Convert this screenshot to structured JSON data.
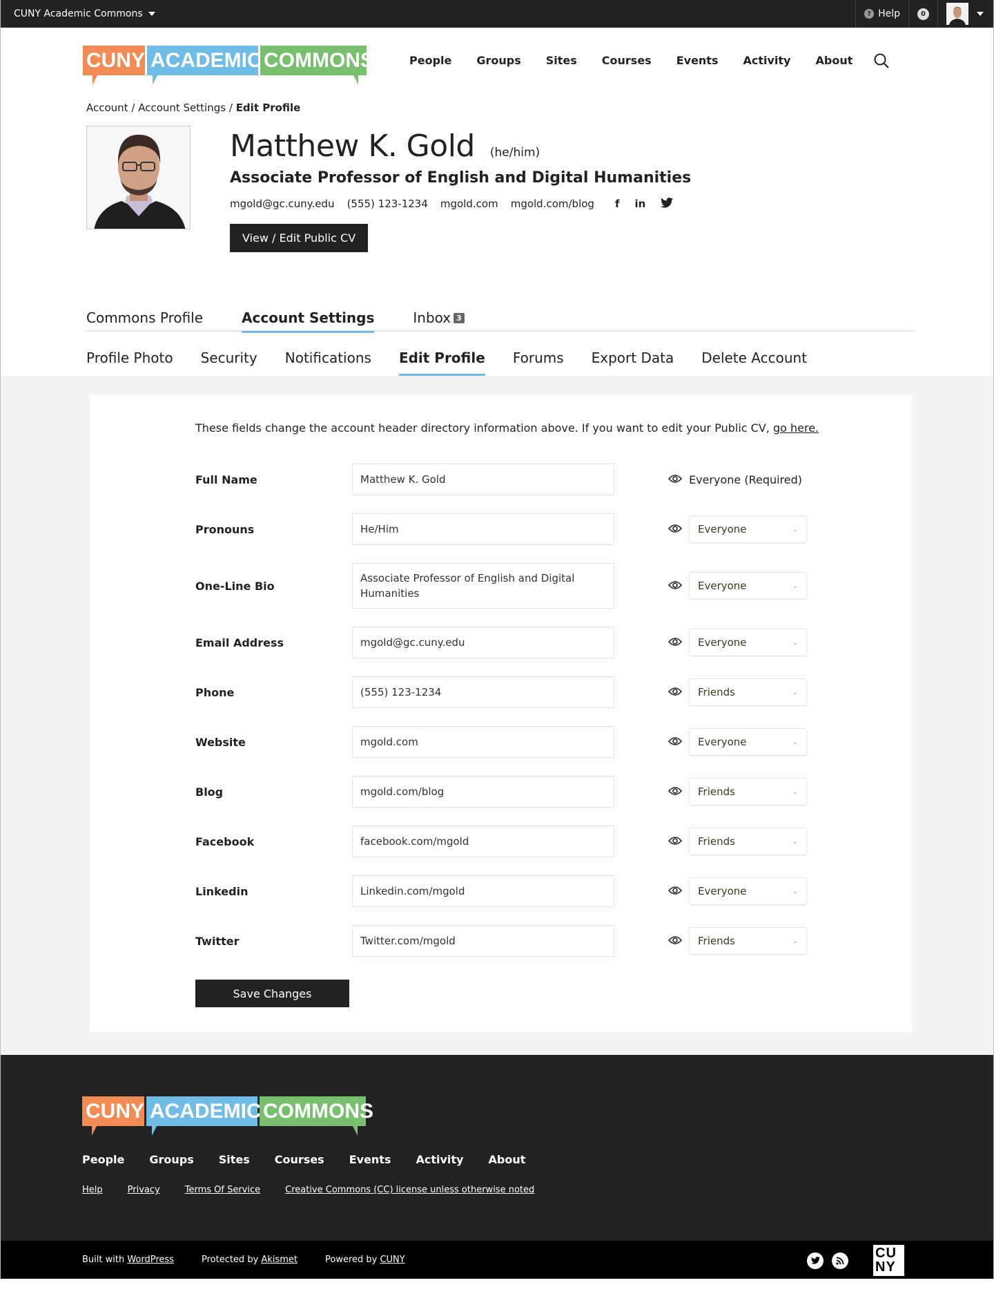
{
  "adminbar": {
    "site_name": "CUNY Academic Commons",
    "help_label": "Help",
    "notification_count": "0"
  },
  "logo": {
    "part1": "CUNY",
    "part2": "ACADEMIC",
    "part3": "COMMONS"
  },
  "nav": [
    "People",
    "Groups",
    "Sites",
    "Courses",
    "Events",
    "Activity",
    "About"
  ],
  "breadcrumb": {
    "item1": "Account",
    "item2": "Account Settings",
    "current": "Edit Profile",
    "separator": "/"
  },
  "profile": {
    "name": "Matthew K. Gold",
    "pronouns": "(he/him)",
    "title": "Associate Professor of English and Digital Humanities",
    "email": "mgold@gc.cuny.edu",
    "phone": "(555) 123-1234",
    "website": "mgold.com",
    "blog": "mgold.com/blog",
    "social": {
      "facebook": "f",
      "linkedin": "in"
    },
    "cv_button": "View / Edit Public CV"
  },
  "tabs": [
    {
      "label": "Commons Profile"
    },
    {
      "label": "Account Settings"
    },
    {
      "label": "Inbox",
      "count": "3"
    }
  ],
  "subtabs": [
    "Profile Photo",
    "Security",
    "Notifications",
    "Edit Profile",
    "Forums",
    "Export Data",
    "Delete Account"
  ],
  "form": {
    "intro": "These fields change the account header directory information above. If you want to edit your Public CV, ",
    "intro_link": "go here.",
    "fields": [
      {
        "label": "Full Name",
        "value": "Matthew K. Gold",
        "visibility": "Everyone (Required)"
      },
      {
        "label": "Pronouns",
        "value": "He/Him",
        "visibility": "Everyone"
      },
      {
        "label": "One-Line Bio",
        "value": "Associate Professor of English and Digital Humanities",
        "visibility": "Everyone"
      },
      {
        "label": "Email Address",
        "value": "mgold@gc.cuny.edu",
        "visibility": "Everyone"
      },
      {
        "label": "Phone",
        "value": "(555) 123-1234",
        "visibility": "Friends"
      },
      {
        "label": "Website",
        "value": "mgold.com",
        "visibility": "Everyone"
      },
      {
        "label": "Blog",
        "value": "mgold.com/blog",
        "visibility": "Friends"
      },
      {
        "label": "Facebook",
        "value": "facebook.com/mgold",
        "visibility": "Friends"
      },
      {
        "label": "Linkedin",
        "value": "Linkedin.com/mgold",
        "visibility": "Everyone"
      },
      {
        "label": "Twitter",
        "value": "Twitter.com/mgold",
        "visibility": "Friends"
      }
    ],
    "save_label": "Save Changes"
  },
  "footer": {
    "nav": [
      "People",
      "Groups",
      "Sites",
      "Courses",
      "Events",
      "Activity",
      "About"
    ],
    "links": [
      "Help",
      "Privacy",
      "Terms Of Service",
      "Creative Commons (CC) license unless otherwise noted"
    ],
    "built_with": "Built with ",
    "built_with_link": "WordPress",
    "protected_by": "Protected by ",
    "protected_by_link": "Akismet",
    "powered_by": "Powered by ",
    "powered_by_link": "CUNY",
    "cuny_mark_line1": "CU",
    "cuny_mark_line2": "NY"
  },
  "colors": {
    "orange": "#f38c54",
    "blue": "#6fbde6",
    "green": "#78bf6e",
    "dark": "#222222"
  }
}
